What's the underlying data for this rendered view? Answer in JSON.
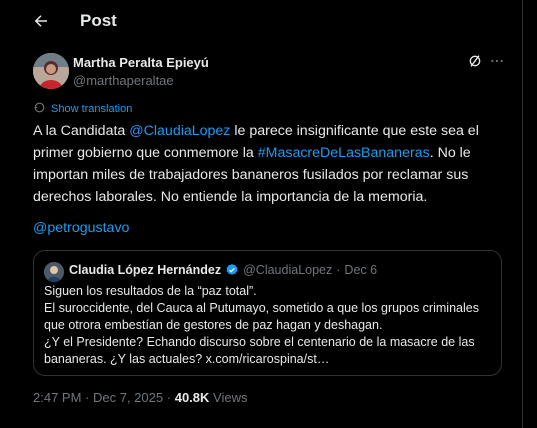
{
  "header": {
    "title": "Post"
  },
  "author": {
    "name": "Martha Peralta Epieyú",
    "handle": "@marthaperaltae"
  },
  "translate": {
    "label": "Show translation"
  },
  "post": {
    "lines": [
      {
        "segments": [
          {
            "t": "A la Candidata ",
            "link": false
          },
          {
            "t": "@ClaudiaLopez",
            "link": true
          },
          {
            "t": " le parece insignificante que este sea el",
            "link": false
          }
        ]
      },
      {
        "segments": [
          {
            "t": "primer gobierno que conmemore la ",
            "link": false
          },
          {
            "t": "#MasacreDeLasBananeras",
            "link": true
          },
          {
            "t": ". No le",
            "link": false
          }
        ]
      },
      {
        "segments": [
          {
            "t": "importan miles de trabajadores bananeros fusilados por reclamar sus",
            "link": false
          }
        ]
      },
      {
        "segments": [
          {
            "t": "derechos laborales. No entiende la importancia de la memoria.",
            "link": false
          }
        ]
      }
    ],
    "mention": "@petrogustavo"
  },
  "quote": {
    "name": "Claudia López Hernández",
    "handle": "@ClaudiaLopez",
    "separator": "·",
    "date": "Dec 6",
    "lines": [
      "Siguen los resultados de la “paz total”.",
      "El suroccidente, del Cauca al Putumayo, sometido a que los grupos criminales",
      "que otrora embestían de gestores de paz hagan y deshagan.",
      "¿Y el Presidente? Echando discurso sobre el centenario de la masacre de las",
      "bananeras. ¿Y las actuales? x.com/ricarospina/st…"
    ]
  },
  "meta": {
    "time": "2:47 PM",
    "separator": "·",
    "date": "Dec 7, 2025",
    "views": "40.8K",
    "views_label": "Views"
  },
  "colors": {
    "accent": "#1d9bf0",
    "background": "#000000",
    "muted": "#71767b",
    "text": "#e7e9ea"
  }
}
